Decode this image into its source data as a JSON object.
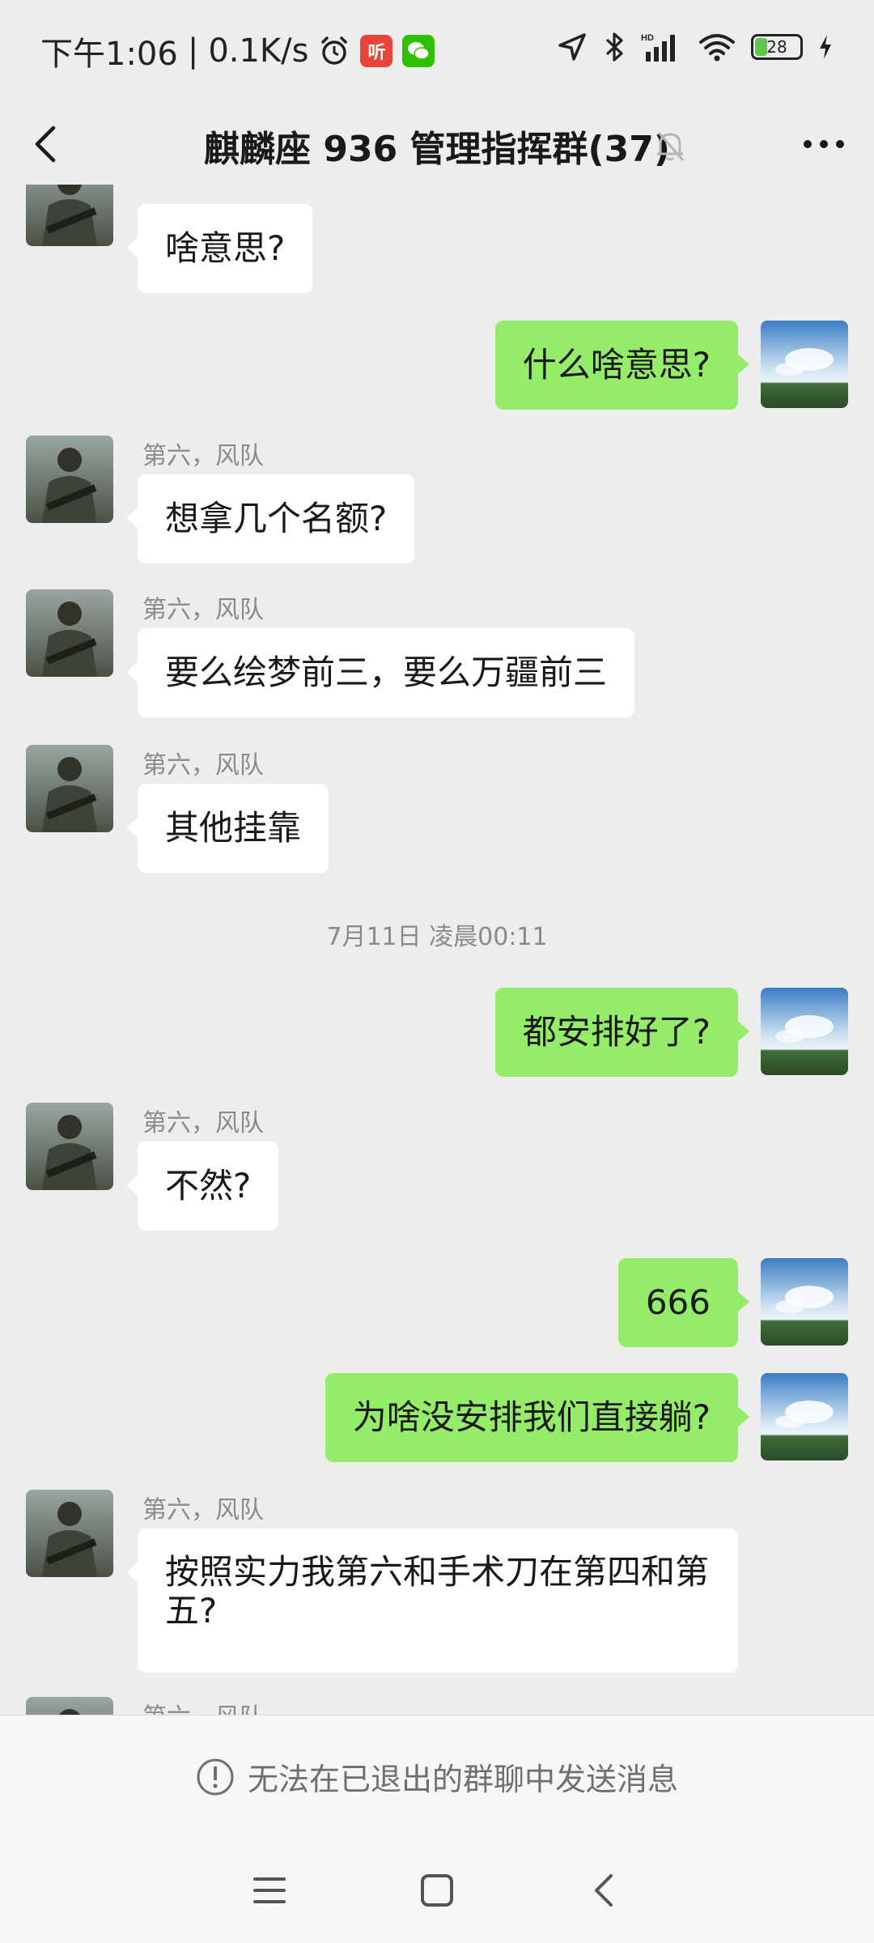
{
  "status_bar": {
    "time": "下午1:06",
    "speed": "0.1K/s",
    "app1": "听",
    "battery": "28",
    "app1_color": "#e8443a",
    "app2_color": "#2dc100",
    "icons": [
      "alarm-icon",
      "location-icon",
      "bluetooth-icon",
      "signal-icon",
      "wifi-icon",
      "battery-icon",
      "charging-icon"
    ]
  },
  "header": {
    "title": "麒麟座 936 管理指挥群(37)"
  },
  "messages": [
    {
      "side": "in",
      "sender": "第六，风队",
      "text": "啥意思?"
    },
    {
      "side": "out",
      "text": "什么啥意思?"
    },
    {
      "side": "in",
      "sender": "第六，风队",
      "text": "想拿几个名额?"
    },
    {
      "side": "in",
      "sender": "第六，风队",
      "text": "要么绘梦前三，要么万疆前三"
    },
    {
      "side": "in",
      "sender": "第六，风队",
      "text": "其他挂靠"
    },
    {
      "side": "time",
      "text": "7月11日 凌晨00:11"
    },
    {
      "side": "out",
      "text": "都安排好了?"
    },
    {
      "side": "in",
      "sender": "第六，风队",
      "text": "不然?"
    },
    {
      "side": "out",
      "text": "666"
    },
    {
      "side": "out",
      "text": "为啥没安排我们直接躺?"
    },
    {
      "side": "in",
      "sender": "第六，风队",
      "text": "按照实力我第六和手术刀在第四和第五?"
    },
    {
      "side": "in",
      "sender": "第六，风队",
      "text": ""
    }
  ],
  "notice": {
    "text": "无法在已退出的群聊中发送消息"
  },
  "colors": {
    "background": "#ededed",
    "outgoing_bubble": "#95ec69",
    "incoming_bubble": "#ffffff"
  }
}
